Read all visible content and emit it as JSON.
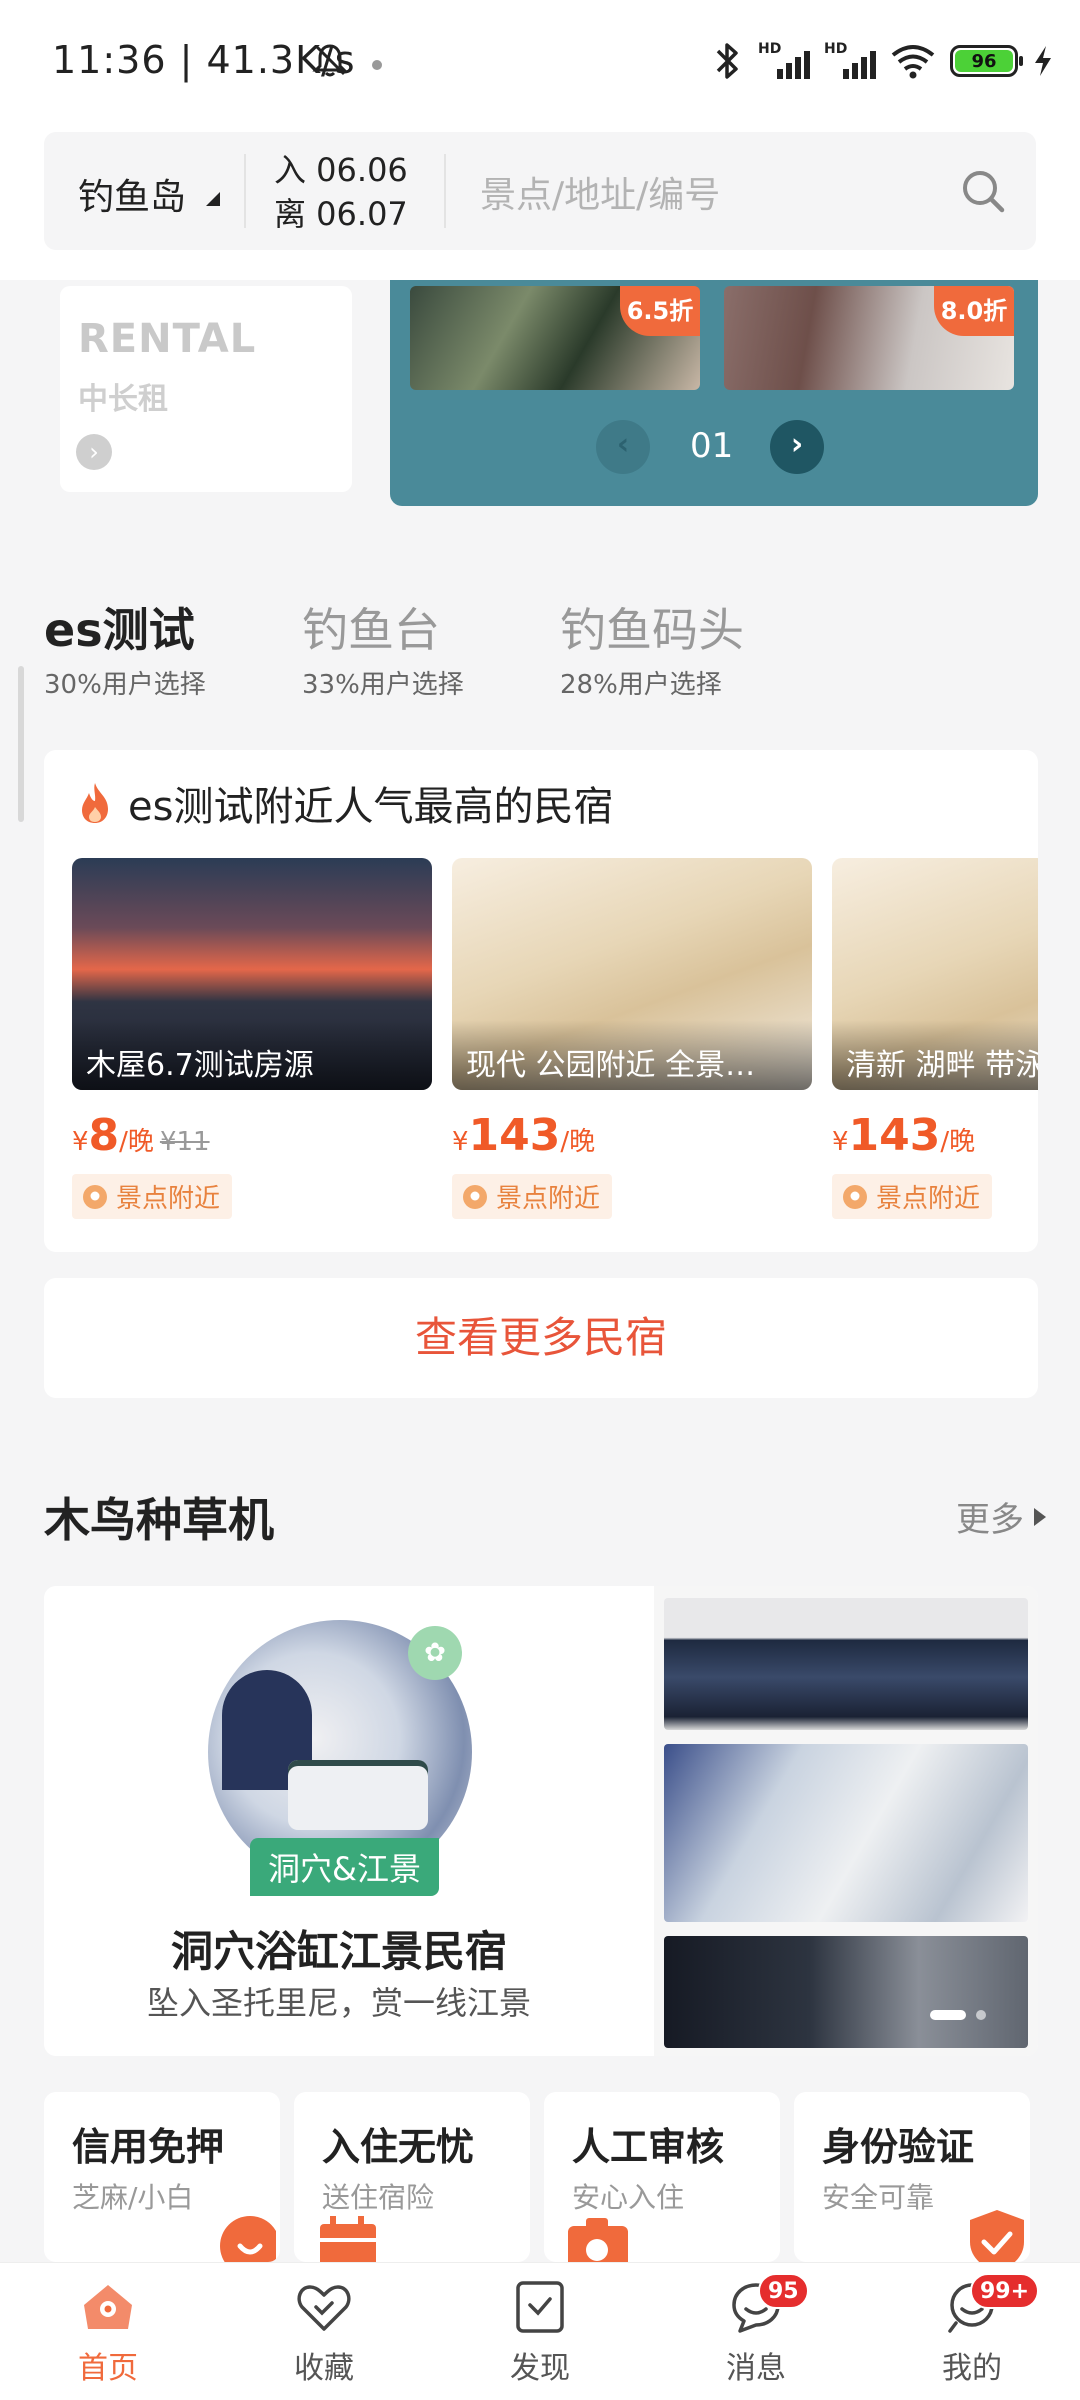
{
  "status_bar": {
    "time": "11:36 | 41.3K/s",
    "battery": "96",
    "signal_hd": "HD"
  },
  "search": {
    "city": "钓鱼岛",
    "checkin": "入 06.06",
    "checkout": "离 06.07",
    "placeholder": "景点/地址/编号"
  },
  "rental": {
    "title_en": "RENTAL",
    "title_cn": "中长租"
  },
  "promo": {
    "discounts": [
      "6.5折",
      "8.0折"
    ],
    "page": "01"
  },
  "destinations": [
    {
      "name": "es测试",
      "share": "30%用户选择",
      "active": true
    },
    {
      "name": "钓鱼台",
      "share": "33%用户选择",
      "active": false
    },
    {
      "name": "钓鱼码头",
      "share": "28%用户选择",
      "active": false
    }
  ],
  "hot": {
    "title": "es测试附近人气最高的民宿",
    "items": [
      {
        "name": "木屋6.7测试房源",
        "currency": "¥",
        "price": "8",
        "unit": "/晚",
        "original": "¥11",
        "badge": "景点附近"
      },
      {
        "name": "现代 公园附近 全景…",
        "currency": "¥",
        "price": "143",
        "unit": "/晚",
        "original": "",
        "badge": "景点附近"
      },
      {
        "name": "清新 湖畔 带泳",
        "currency": "¥",
        "price": "143",
        "unit": "/晚",
        "original": "",
        "badge": "景点附近"
      }
    ],
    "more_label": "查看更多民宿"
  },
  "section": {
    "title": "木鸟种草机",
    "more": "更多"
  },
  "feature": {
    "tag": "洞穴&江景",
    "name": "洞穴浴缸江景民宿",
    "desc": "坠入圣托里尼，赏一线江景"
  },
  "guarantees": [
    {
      "title": "信用免押",
      "sub": "芝麻/小白",
      "icon": "smile-icon"
    },
    {
      "title": "入住无忧",
      "sub": "送住宿险",
      "icon": "calendar-icon"
    },
    {
      "title": "人工审核",
      "sub": "安心入住",
      "icon": "camera-icon"
    },
    {
      "title": "身份验证",
      "sub": "安全可靠",
      "icon": "shield-check-icon"
    }
  ],
  "tabs": [
    {
      "label": "首页",
      "icon": "home-icon",
      "active": true,
      "badge": ""
    },
    {
      "label": "收藏",
      "icon": "heart-icon",
      "active": false,
      "badge": ""
    },
    {
      "label": "发现",
      "icon": "discover-icon",
      "active": false,
      "badge": ""
    },
    {
      "label": "消息",
      "icon": "message-icon",
      "active": false,
      "badge": "95"
    },
    {
      "label": "我的",
      "icon": "profile-icon",
      "active": false,
      "badge": "99+"
    }
  ],
  "colors": {
    "accent": "#f06a3c",
    "price": "#f05a28",
    "promo_bg": "#4a8a99",
    "tag_green": "#3aa97a"
  }
}
